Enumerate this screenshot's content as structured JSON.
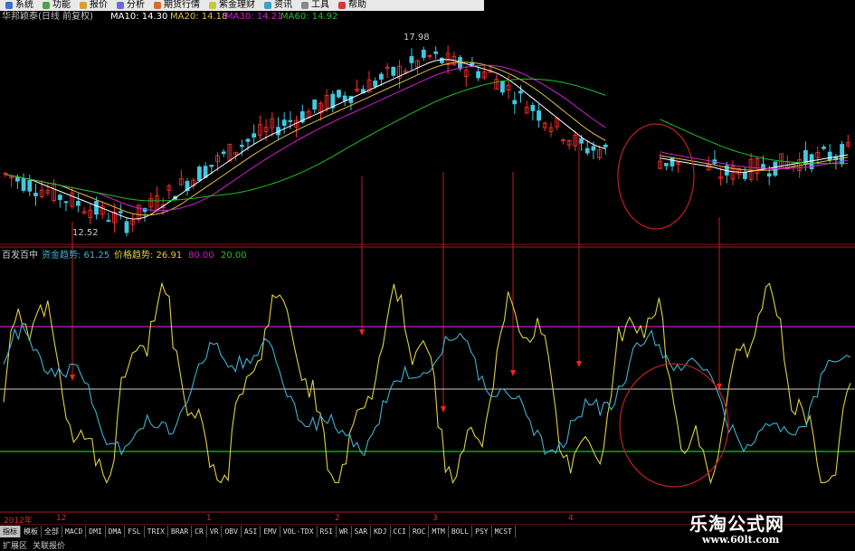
{
  "menu": {
    "items": [
      "系统",
      "功能",
      "报价",
      "分析",
      "期货行情",
      "紫金理财",
      "资讯",
      "工具",
      "帮助"
    ]
  },
  "top_panel": {
    "stock_name": "华邦颖泰(日线 前复权)",
    "ma10_label": "MA10: 14.30",
    "ma20_label": "MA20: 14.18",
    "ma30_label": "MA30: 14.21",
    "ma60_label": "MA60: 14.92",
    "high_label": "17.98",
    "low_label": "12.52",
    "colors": {
      "ma10": "#ffffff",
      "ma20": "#e0c040",
      "ma30": "#d020d0",
      "ma60": "#20c020"
    }
  },
  "bottom_panel": {
    "indicator_name": "百发百中",
    "fund_trend_label": "资金趋势: 61.25",
    "price_trend_label": "价格趋势: 26.91",
    "level_80": "80.00",
    "level_20": "20.00",
    "colors": {
      "fund": "#40b0d0",
      "price": "#e0d040",
      "line80": "#c020c0",
      "line50": "#cccccc",
      "line20": "#20c020"
    }
  },
  "time_axis": {
    "labels": [
      "2012年",
      "12",
      "1",
      "2",
      "3",
      "4"
    ]
  },
  "tabs": {
    "items": [
      "指标",
      "模板",
      "全部",
      "MACD",
      "DMI",
      "DMA",
      "FSL",
      "TRIX",
      "BRAR",
      "CR",
      "VR",
      "OBV",
      "ASI",
      "EMV",
      "VOL-TDX",
      "RSI",
      "WR",
      "SAR",
      "KDJ",
      "CCI",
      "ROC",
      "MTM",
      "BOLL",
      "PSY",
      "MCST"
    ],
    "active_index": 0
  },
  "bottom_bar": {
    "items": [
      "扩展区",
      "关联报价"
    ]
  },
  "watermark": {
    "title": "乐淘公式网",
    "url": "www.60lt.com"
  }
}
